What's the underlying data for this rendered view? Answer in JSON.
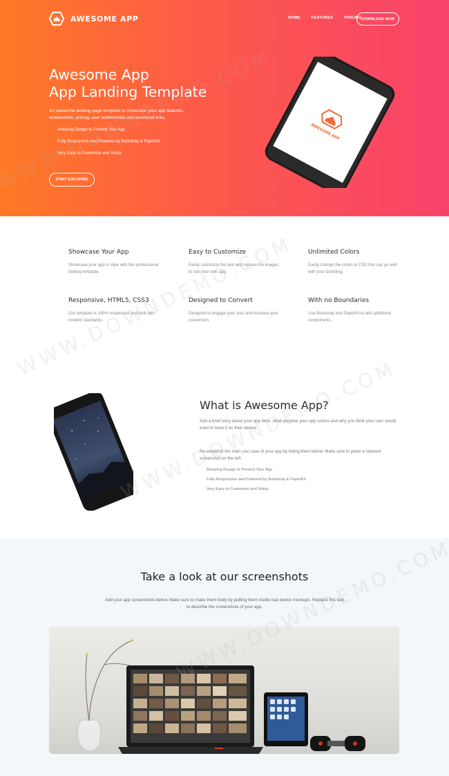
{
  "nav": {
    "brand": "AWESOME APP",
    "links": [
      "HOME",
      "FEATURES",
      "PRICING"
    ],
    "cta": "DOWNLOAD NOW"
  },
  "hero": {
    "title_line1": "Awesome App",
    "title_line2": "App Landing Template",
    "description": "An awesome landing page template to showcase your app features, screenshots, pricing, user testimonials and download links.",
    "list": [
      "Amazing Design to Present Your App",
      "Fully Responsive and Powered by Bootstrap & PaperKit",
      "Very Easy to Customize and Setup"
    ],
    "button": "START EXPLORING",
    "phone_screen_brand": "AWESOME APP"
  },
  "features": [
    {
      "title": "Showcase Your App",
      "text": "Showcase your app in style with this professional looking template."
    },
    {
      "title": "Easy to Customize",
      "text": "Easily customize the text and replace the images to suit your own app."
    },
    {
      "title": "Unlimited Colors",
      "text": "Easily change the colors in CSS that can go well with your branding."
    },
    {
      "title": "Responsive, HTML5, CSS3",
      "text": "Our template is 100% responsive and built with modern standards."
    },
    {
      "title": "Designed to Convert",
      "text": "Designed to engage your user and increase your conversion."
    },
    {
      "title": "With no Boundaries",
      "text": "Use Bootstrap and PaperKit to add additional components."
    }
  ],
  "about": {
    "title": "What is Awesome App?",
    "p1": "Add a brief story about your app here, what purpose your app solves and why you think your user would want to have it on their device.",
    "p2": "Re-establish the main use case of your app by listing them below. Make sure to place a relavent screenshot on the left.",
    "list": [
      "Amazing Design to Present Your App",
      "Fully Responsive and Powered by Bootstrap & PaperKit",
      "Very Easy to Customize and Setup"
    ]
  },
  "screenshots": {
    "title": "Take a look at our screenshots",
    "text": "Add your app screenshots below. Make sure to make them lively by putting them inside real device mockups. Replace this text to describe the screenshots of your app."
  },
  "watermark": "WWW.DOWNDEMO.COM",
  "colors": {
    "gradient_start": "#fe7a25",
    "gradient_end": "#f8426b",
    "accent": "#fd5a49"
  }
}
